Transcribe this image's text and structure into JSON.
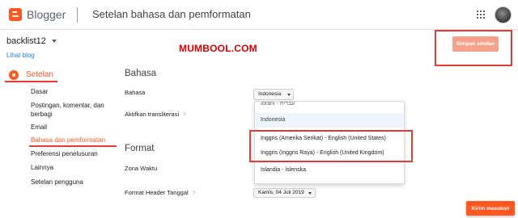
{
  "header": {
    "brand": "Blogger",
    "title": "Setelan bahasa dan pemformatan"
  },
  "blog": {
    "name": "backlist12",
    "view_link": "Lihat blog"
  },
  "watermark": "MUMBOOL.COM",
  "actions": {
    "save_label": "Simpan setelan",
    "feedback_label": "Kirim masukan"
  },
  "sidebar": {
    "section_label": "Setelan",
    "items": [
      {
        "label": "Dasar"
      },
      {
        "label": "Postingan, komentar, dan"
      },
      {
        "label": "berbagi"
      },
      {
        "label": "Email"
      },
      {
        "label": "Bahasa dan pemformatan"
      },
      {
        "label": "Preferensi penelusuran"
      },
      {
        "label": "Lainnya"
      },
      {
        "label": "Setelan pengguna"
      }
    ]
  },
  "content": {
    "language_heading": "Bahasa",
    "language_label": "Bahasa",
    "language_value": "Indonesia",
    "transliteration_label": "Aktifkan transliterasi",
    "help_mark": "?",
    "format_heading": "Format",
    "timezone_label": "Zona Waktu",
    "date_format_label": "Format Header Tanggal",
    "date_format_value": "Kamis, 04 Juli 2019"
  },
  "language_dropdown": {
    "options": [
      {
        "label": "Ibrani - עברית"
      },
      {
        "label": "Indonesia"
      },
      {
        "label": "Inggris (Amerika Serikat) - English (United States)"
      },
      {
        "label": "Inggris (Inggris Raya) - English (United Kingdom)"
      },
      {
        "label": "Islandia - íslenska"
      }
    ]
  },
  "colors": {
    "accent": "#ff5722",
    "highlight_box": "#e53935",
    "link": "#1e88e5"
  }
}
